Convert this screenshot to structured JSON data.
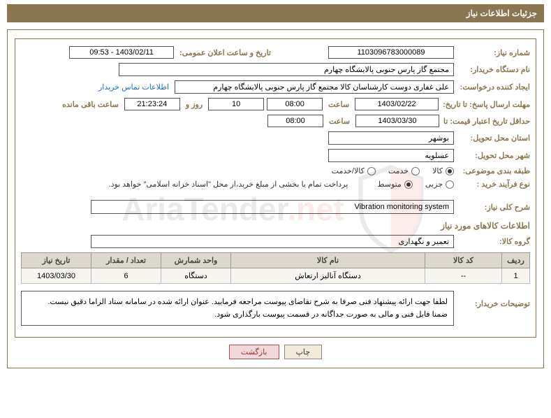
{
  "header": {
    "title": "جزئیات اطلاعات نیاز"
  },
  "fields": {
    "need_no_label": "شماره نیاز:",
    "need_no": "1103096783000089",
    "publish_label": "تاریخ و ساعت اعلان عمومی:",
    "publish_value": "1403/02/11 - 09:53",
    "buyer_org_label": "نام دستگاه خریدار:",
    "buyer_org": "مجتمع گاز پارس جنوبی  پالایشگاه چهارم",
    "requester_label": "ایجاد کننده درخواست:",
    "requester": "علی غفاری دوست کارشناسان کالا مجتمع گاز پارس جنوبی  پالایشگاه چهارم",
    "contact_link": "اطلاعات تماس خریدار",
    "deadline_label": "مهلت ارسال پاسخ: تا تاریخ:",
    "deadline_date": "1403/02/22",
    "time_label": "ساعت",
    "deadline_time": "08:00",
    "days_value": "10",
    "days_and_label": "روز و",
    "countdown": "21:23:24",
    "remaining_label": "ساعت باقی مانده",
    "validity_label": "حداقل تاریخ اعتبار قیمت: تا",
    "validity_date": "1403/03/30",
    "validity_time": "08:00",
    "province_label": "استان محل تحویل:",
    "province": "بوشهر",
    "city_label": "شهر محل تحویل:",
    "city": "عسلویه",
    "category_label": "طبقه بندی موضوعی:",
    "process_label": "نوع فرآیند خرید :",
    "treasury_note": "پرداخت تمام یا بخشی از مبلغ خرید،از محل \"اسناد خزانه اسلامی\" خواهد بود.",
    "general_desc_label": "شرح کلی نیاز:",
    "general_desc": "Vibration monitoring system",
    "items_section": "اطلاعات کالاهای مورد نیاز",
    "group_label": "گروه کالا:",
    "group_value": "تعمیر و نگهداری",
    "buyer_note_label": "توضیحات خریدار:",
    "buyer_note_line1": "لطفا جهت ارائه پیشنهاد فنی صرفا به شرح تقاضای پیوست مراجعه فرمایید. عنوان ارائه شده در سامانه ستاد الزاما دقیق نیست.",
    "buyer_note_line2": "ضمنا فایل فنی و مالی به صورت جداگانه در قسمت پیوست بارگذاری شود."
  },
  "radios": {
    "category": {
      "opt1": "کالا",
      "opt2": "خدمت",
      "opt3": "کالا/خدمت",
      "selected": "opt1"
    },
    "process": {
      "opt1": "جزیی",
      "opt2": "متوسط",
      "selected": "opt2"
    }
  },
  "table": {
    "headers": {
      "row": "ردیف",
      "code": "کد کالا",
      "name": "نام کالا",
      "uom": "واحد شمارش",
      "qty": "تعداد / مقدار",
      "date": "تاریخ نیاز"
    },
    "rows": [
      {
        "row": "1",
        "code": "--",
        "name": "دستگاه آنالیز ارتعاش",
        "uom": "دستگاه",
        "qty": "6",
        "date": "1403/03/30"
      }
    ]
  },
  "buttons": {
    "print": "چاپ",
    "back": "بازگشت"
  },
  "watermark": {
    "text_part1": "AriaTender",
    "text_part2": ".net"
  }
}
